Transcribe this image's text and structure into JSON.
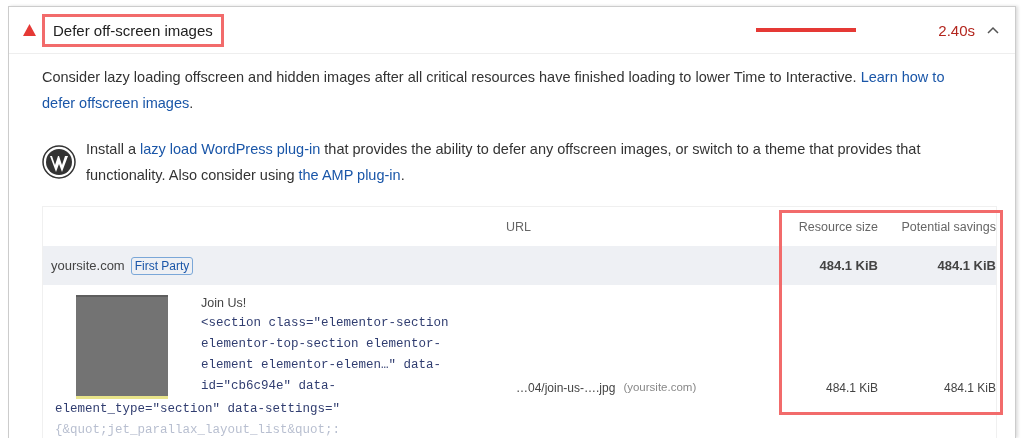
{
  "audit": {
    "title": "Defer off-screen images",
    "title_highlighted": true,
    "timing": "2.40s",
    "expanded": true,
    "description": [
      {
        "text": "Consider lazy loading offscreen and hidden images after all critical resources have finished loading to lower Time to Interactive. "
      },
      {
        "text": "Learn how to",
        "link": true
      },
      {
        "text": "defer offscreen images",
        "link": true
      },
      {
        "text": "."
      }
    ],
    "stack_pack": [
      {
        "text": "Install a "
      },
      {
        "text": "lazy load WordPress plug-in",
        "link": true
      },
      {
        "text": " that provides the ability to defer any offscreen images, or switch to a theme that provides that functionality. Also consider using "
      },
      {
        "text": "the AMP plug-in",
        "link": true
      },
      {
        "text": "."
      }
    ],
    "table": {
      "columns": [
        {
          "label": "URL"
        },
        {
          "label": "Resource size"
        },
        {
          "label": "Potential savings"
        }
      ],
      "size_columns_highlighted": true,
      "group": {
        "entity": "yoursite.com",
        "badge": "First Party",
        "resource_size": "484.1 KiB",
        "potential_savings": "484.1 KiB"
      },
      "items": [
        {
          "kind": "picture",
          "label": "Join Us!",
          "code_lines": [
            "<section class=\"elementor-section",
            "elementor-top-section elementor-",
            "element elementor-elemen…\" data-",
            "id=\"cb6c94e\" data-"
          ],
          "code_lines_below": [
            "element_type=\"section\" data-settings=\"",
            "{&quot;jet_parallax_layout_list&quot;:"
          ],
          "url": "…04/join-us-….jpg",
          "origin": "(yoursite.com)",
          "resource_size": "484.1 KiB",
          "potential_savings": "484.1 KiB"
        }
      ]
    }
  }
}
